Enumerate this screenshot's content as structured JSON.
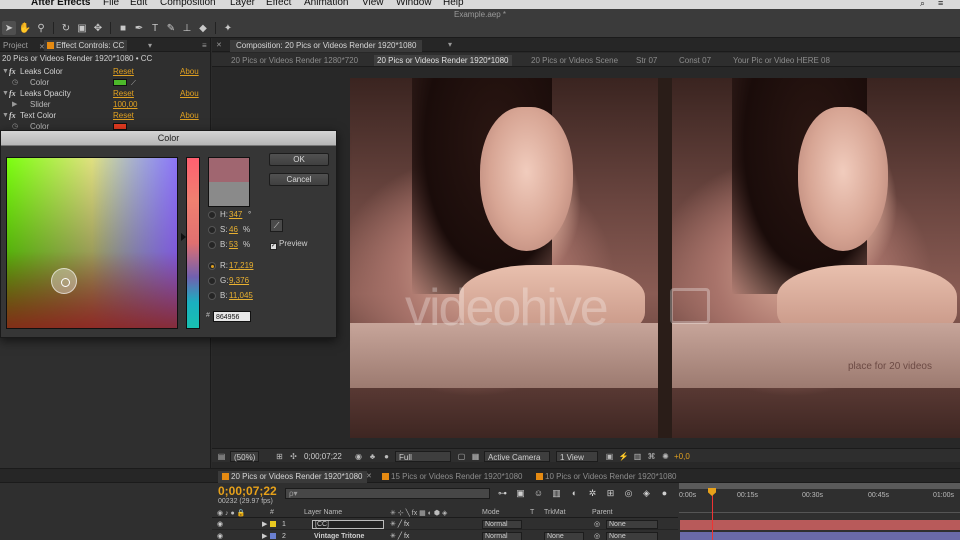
{
  "menubar": {
    "app_name": "After Effects",
    "items": [
      "File",
      "Edit",
      "Composition",
      "Layer",
      "Effect",
      "Animation",
      "View",
      "Window",
      "Help"
    ]
  },
  "toolbar": {
    "document_title": "Example.aep *"
  },
  "left_panel": {
    "tabs": [
      "Project",
      "Effect Controls: CC"
    ],
    "header": "20 Pics or Videos Render 1920*1080 • CC",
    "rows": [
      {
        "type": "effect",
        "label": "Leaks Color",
        "reset": "Reset",
        "about": "Abou"
      },
      {
        "type": "param",
        "label": "Color",
        "swatch": "#4cb82a"
      },
      {
        "type": "effect",
        "label": "Leaks Opacity",
        "reset": "Reset",
        "about": "Abou"
      },
      {
        "type": "param",
        "label": "Slider",
        "value": "100,00"
      },
      {
        "type": "effect",
        "label": "Text Color",
        "reset": "Reset",
        "about": "Abou"
      },
      {
        "type": "param",
        "label": "Color",
        "swatch": "#e03a20"
      }
    ]
  },
  "color_dialog": {
    "title": "Color",
    "ok_label": "OK",
    "cancel_label": "Cancel",
    "preview_label": "Preview",
    "fields": [
      {
        "label": "H:",
        "value": "347",
        "unit": "°",
        "selected": false
      },
      {
        "label": "S:",
        "value": "46",
        "unit": "%",
        "selected": false
      },
      {
        "label": "B:",
        "value": "53",
        "unit": "%",
        "selected": false
      },
      {
        "label": "R:",
        "value": "17,219",
        "unit": "",
        "selected": true
      },
      {
        "label": "G:",
        "value": "9,376",
        "unit": "",
        "selected": false
      },
      {
        "label": "B:",
        "value": "11,045",
        "unit": "",
        "selected": false
      }
    ],
    "hex": "864956",
    "new_color": "#a06670",
    "old_color": "#8a8a8a"
  },
  "composition": {
    "tab_label": "Composition: 20 Pics or Videos Render 1920*1080",
    "breadcrumbs": [
      "20 Pics or Videos Render 1280*720",
      "20 Pics or Videos Render 1920*1080",
      "20 Pics or Videos Scene",
      "Str 07",
      "Const 07",
      "Your Pic or Video HERE 08"
    ],
    "active_breadcrumb": 1,
    "watermark": "videohive",
    "caption": "place for 20 videos"
  },
  "viewer_bar": {
    "zoom": "(50%)",
    "timecode": "0;00;07;22",
    "resolution": "Full",
    "camera": "Active Camera",
    "views": "1 View",
    "exposure": "+0,0"
  },
  "timeline": {
    "tabs": [
      "20 Pics or Videos Render 1920*1080",
      "15 Pics or Videos Render 1920*1080",
      "10 Pics or Videos Render 1920*1080"
    ],
    "timecode": "0;00;07;22",
    "fps": "00232 (29.97 fps)",
    "search_placeholder": "ρ▾",
    "ruler": [
      "0:00s",
      "00:15s",
      "00:30s",
      "00:45s",
      "01:00s"
    ],
    "columns": {
      "num": "#",
      "name": "Layer Name",
      "mode": "Mode",
      "t": "T",
      "trkmat": "TrkMat",
      "parent": "Parent"
    },
    "layers": [
      {
        "num": "1",
        "name": "[CC]",
        "color": "#e8c820",
        "mode": "Normal",
        "parent": "None",
        "bar_color": "#b85a5a"
      },
      {
        "num": "2",
        "name": "Vintage Tritone",
        "color": "#6a7fd0",
        "mode": "Normal",
        "trkmat": "None",
        "parent": "None",
        "bar_color": "#6a6aa8"
      }
    ]
  }
}
